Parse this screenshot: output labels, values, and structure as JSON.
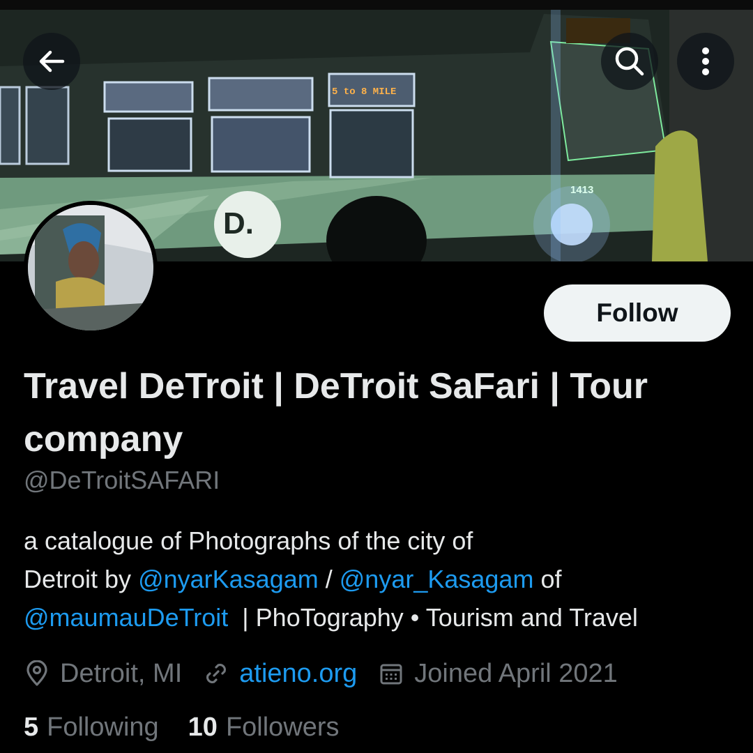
{
  "profile": {
    "display_name": "Travel DeTroit | DeTroit SaFari | Tour company",
    "handle": "@DeTroitSAFARI",
    "follow_label": "Follow",
    "bio": {
      "line1": "a catalogue of Photographs of the city of",
      "line2_prefix": "Detroit by ",
      "mention1": "@nyarKasagam",
      "sep": " / ",
      "mention2": "@nyar_Kasagam",
      "line2_suffix": " of",
      "mention3": "@maumauDeTroit",
      "line3_suffix": "  | PhoTography • Tourism and Travel"
    },
    "location": "Detroit, MI",
    "website": "atieno.org",
    "joined": "Joined April 2021",
    "following_count": "5",
    "following_label": "Following",
    "followers_count": "10",
    "followers_label": "Followers"
  },
  "banner": {
    "bus_sign": "5 to 8 MILE",
    "bus_number": "1413",
    "bus_logo": "D."
  },
  "icons": {
    "back": "arrow-left-icon",
    "search": "search-icon",
    "more": "more-vertical-icon",
    "location": "location-pin-icon",
    "link": "link-icon",
    "calendar": "calendar-icon"
  },
  "colors": {
    "background": "#000000",
    "link": "#1d9bf0",
    "secondary_text": "#71767b",
    "primary_text": "#e7e9ea",
    "follow_bg": "#eff3f4"
  }
}
